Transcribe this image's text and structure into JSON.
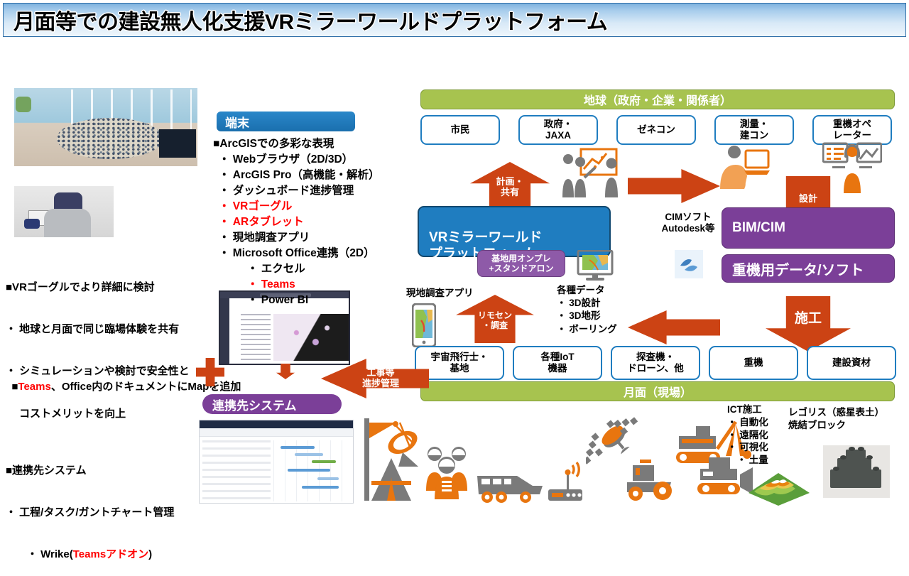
{
  "title": "月面等での建設無人化支援VRミラーワールドプラットフォーム",
  "left_column": {
    "terminal_panel": {
      "header": "端末",
      "heading": "■ArcGISでの多彩な表現",
      "items": [
        {
          "label": "・ Webブラウザ（2D/3D）",
          "red": false,
          "indent": 1
        },
        {
          "label": "・ ArcGIS Pro（高機能・解析）",
          "red": false,
          "indent": 1
        },
        {
          "label": "・ ダッシュボード進捗管理",
          "red": false,
          "indent": 1
        },
        {
          "label": "・ VRゴーグル",
          "red": true,
          "indent": 1
        },
        {
          "label": "・ ARタブレット",
          "red": true,
          "indent": 1
        },
        {
          "label": "・ 現地調査アプリ",
          "red": false,
          "indent": 1
        },
        {
          "label": "・ Microsoft Office連携（2D）",
          "red": false,
          "indent": 1
        },
        {
          "label": "・ エクセル",
          "red": false,
          "indent": 2
        },
        {
          "label": "・ Teams",
          "red": true,
          "indent": 2
        },
        {
          "label": "・ Power BI",
          "red": false,
          "indent": 2
        }
      ]
    },
    "vr_note": {
      "heading": "■VRゴーグルでより詳細に検討",
      "lines": [
        "・ 地球と月面で同じ臨場体験を共有",
        "・ シミュレーションや検討で安全性と",
        "　 コストメリットを向上"
      ]
    },
    "teams_note": {
      "prefix": "■",
      "red": "Teams",
      "rest": "、Office内のドキュメントにMapを追加"
    },
    "linked_system_note": {
      "heading": "■連携先システム",
      "line1": "・ 工程/タスク/ガントチャート管理",
      "line2_prefix": "　　・ Wrike(",
      "line2_red": "Teamsアドオン",
      "line2_suffix": ")"
    },
    "linked_system_chip": "連携先システム"
  },
  "diagram": {
    "earth_banner": "地球（政府・企業・関係者）",
    "earth_actors": [
      "市民",
      "政府・\nJAXA",
      "ゼネコン",
      "測量・\n建コン",
      "重機オペ\nレーター"
    ],
    "moon_banner": "月面（現場）",
    "moon_actors": [
      "宇宙飛行士・\n基地",
      "各種IoT\n機器",
      "探査機・\nドローン、他",
      "重機",
      "建設資材"
    ],
    "vr_platform": "VRミラーワールド\nプラットフォーム",
    "onprem_chip": "基地用オンプレ\n+スタンドアロン",
    "bim_cim": "BIM/CIM",
    "heavy_machine_data": "重機用データ/ソフト",
    "cim_soft_label": "CIMソフト\nAutodesk等",
    "field_app_label": "現地調査アプリ",
    "data_types_label": "各種データ\n・ 3D設計\n・ 3D地形\n・ ボーリング",
    "arrows": {
      "plan_share": "計画・\n共有",
      "design": "設計",
      "construction": "施工",
      "remote_sensing": "リモセン\n・調査",
      "progress_mgmt": "工事等\n進捗管理"
    },
    "ict_label": "ICT施工\n・ 自動化\n・ 遠隔化\n・ 可視化\n　・ 土量",
    "regolith_label": "レゴリス（惑星表土）\n焼結ブロック"
  },
  "colors": {
    "title_blue": "#7fb3df",
    "green": "#a7c34f",
    "blue": "#1f7dc0",
    "purple": "#7b3f98",
    "purple_light": "#8e5aa8",
    "orange_arrow": "#cc4314",
    "icon_orange": "#e8750f",
    "icon_grey": "#7a7a7a",
    "red_text": "#ff0000"
  }
}
